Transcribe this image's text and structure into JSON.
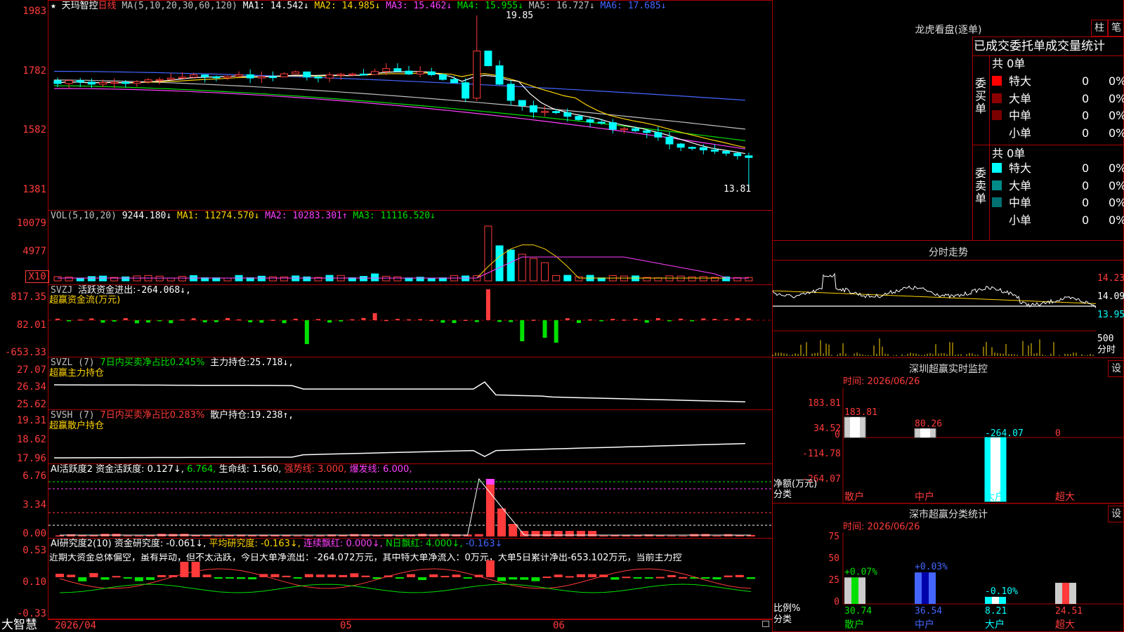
{
  "app": {
    "brand": "大智慧",
    "date_axis": [
      "2026/04",
      "05",
      "06"
    ]
  },
  "main": {
    "stock": "天玛智控",
    "period": "日线",
    "ma_header": "MA(5,10,20,30,60,120)",
    "ma": [
      {
        "label": "MA1:",
        "value": "14.542↓",
        "color": "#ffffff"
      },
      {
        "label": "MA2:",
        "value": "14.985↓",
        "color": "#ffd400"
      },
      {
        "label": "MA3:",
        "value": "15.462↓",
        "color": "#ff40ff"
      },
      {
        "label": "MA4:",
        "value": "15.955↓",
        "color": "#00e000"
      },
      {
        "label": "MA5:",
        "value": "16.727↓",
        "color": "#c0c0c0"
      },
      {
        "label": "MA6:",
        "value": "17.685↓",
        "color": "#4466ff"
      }
    ],
    "y_ticks": [
      "1983",
      "1782",
      "1582",
      "1381"
    ],
    "high_label": "19.85",
    "low_label": "13.81"
  },
  "vol": {
    "header": "VOL(5,10,20)",
    "value": "9244.180↓",
    "ma": [
      {
        "label": "MA1:",
        "value": "11274.570↓",
        "color": "#ffd400"
      },
      {
        "label": "MA2:",
        "value": "10283.301↑",
        "color": "#ff40ff"
      },
      {
        "label": "MA3:",
        "value": "11116.520↓",
        "color": "#00e000"
      }
    ],
    "y_ticks": [
      "10079",
      "4977"
    ],
    "multiplier": "X10"
  },
  "svzj": {
    "header": "SVZJ",
    "label": "活跃资金进出:",
    "value": "-264.068↓,",
    "subtitle": "超赢资金流(万元)",
    "y_ticks": [
      "817.35",
      "82.01",
      "-653.33"
    ]
  },
  "svzl": {
    "header": "SVZL (7)",
    "ratio": "7日内买卖净占比0.245%",
    "label": "主力持仓:",
    "value": "25.718↓,",
    "subtitle": "超赢主力持仓",
    "y_ticks": [
      "27.07",
      "26.34",
      "25.62"
    ]
  },
  "svsh": {
    "header": "SVSH (7)",
    "ratio": "7日内买卖净占比0.283%",
    "label": "散户持仓:",
    "value": "19.238↑,",
    "subtitle": "超赢散户持仓",
    "y_ticks": [
      "19.31",
      "18.62",
      "17.96"
    ]
  },
  "ai1": {
    "header": "AI活跃度2",
    "label": "资金活跃度:",
    "value1": "0.127↓,",
    "value2": "6.764,",
    "life": "生命线: 1.560,",
    "strong": "强势线: 3.000,",
    "burst": "爆发线: 6.000,",
    "y_ticks": [
      "6.76",
      "3.34",
      "0.00"
    ]
  },
  "ai2": {
    "header": "AI研究度2(10)",
    "label": "资金研究度:",
    "value": "-0.061↓,",
    "avg": "平均研究度: -0.163↓,",
    "red": "连续飘红: 0.000↓,",
    "nred": "N日飘红: 4.000↓,",
    "last": "-0.163↓",
    "note": "近期大资金总体偏空，虽有异动，但不太活跃，今日大单净流出：-264.072万元，其中特大单净流入：0万元，大单5日累计净出-653.102万元，当前主力控",
    "y_ticks": [
      "0.53",
      "0.10",
      "-0.33"
    ]
  },
  "lhb": {
    "title": "龙虎看盘(逐单)",
    "btn1": "柱",
    "btn2": "笔",
    "subtitle": "已成交委托单成交量统计",
    "buy": {
      "side": "委买单",
      "total": "共 0单",
      "rows": [
        {
          "name": "特大",
          "n": "0",
          "p": "0%",
          "color": "#ff0000"
        },
        {
          "name": "大单",
          "n": "0",
          "p": "0%",
          "color": "#8b0000"
        },
        {
          "name": "中单",
          "n": "0",
          "p": "0%",
          "color": "#7a0000"
        },
        {
          "name": "小单",
          "n": "0",
          "p": "0%",
          "color": "#000000"
        }
      ]
    },
    "sell": {
      "side": "委卖单",
      "total": "共 0单",
      "rows": [
        {
          "name": "特大",
          "n": "0",
          "p": "0%",
          "color": "#00ffff"
        },
        {
          "name": "大单",
          "n": "0",
          "p": "0%",
          "color": "#008b8b"
        },
        {
          "name": "中单",
          "n": "0",
          "p": "0%",
          "color": "#007070"
        },
        {
          "name": "小单",
          "n": "0",
          "p": "0%",
          "color": "#000000"
        }
      ]
    }
  },
  "intraday": {
    "title": "分时走势",
    "right_ticks": [
      "14.23",
      "14.09",
      "13.95"
    ],
    "vol_tick": "500",
    "vol_label": "分时"
  },
  "monitor": {
    "title": "深圳超赢实时监控",
    "btn": "设",
    "time": "时间: 2026/06/26",
    "y_ticks": [
      "183.81",
      "34.52",
      "0",
      "-114.78",
      "-264.07"
    ],
    "ylabel": "净额(万元)",
    "xlabel": "分类",
    "chart_data": {
      "type": "bar",
      "categories": [
        "散户",
        "中户",
        "大户",
        "超大"
      ],
      "values": [
        183.81,
        80.26,
        -264.07,
        0
      ],
      "value_labels": [
        "183.81",
        "80.26",
        "-264.07",
        "0"
      ],
      "ylim": [
        -264.07,
        183.81
      ],
      "ylabel": "净额(万元)",
      "xlabel": "分类"
    }
  },
  "classify": {
    "title": "深市超赢分类统计",
    "btn": "设",
    "time": "时间: 2026/06/26",
    "y_ticks": [
      "75",
      "50",
      "25",
      "0"
    ],
    "ylabel": "比例%",
    "xlabel": "分类",
    "chart_data": {
      "type": "bar",
      "categories": [
        "散户",
        "中户",
        "大户",
        "超大"
      ],
      "values": [
        30.74,
        36.54,
        8.21,
        24.51
      ],
      "changes": [
        "+0.07%",
        "+0.03%",
        "-0.10%",
        ""
      ],
      "ylim": [
        0,
        75
      ],
      "ylabel": "比例%",
      "xlabel": "分类"
    }
  },
  "colors": {
    "up": "#ff3b3b",
    "down": "#00ffff",
    "grid": "#a00000",
    "green_bar": "#00e000"
  }
}
